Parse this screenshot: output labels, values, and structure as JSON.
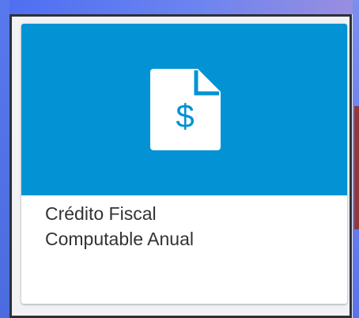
{
  "card": {
    "title": "Crédito Fiscal\nComputable Anual",
    "icon": "document-dollar-icon",
    "icon_symbol": "$",
    "media_color": "#0393d4"
  }
}
